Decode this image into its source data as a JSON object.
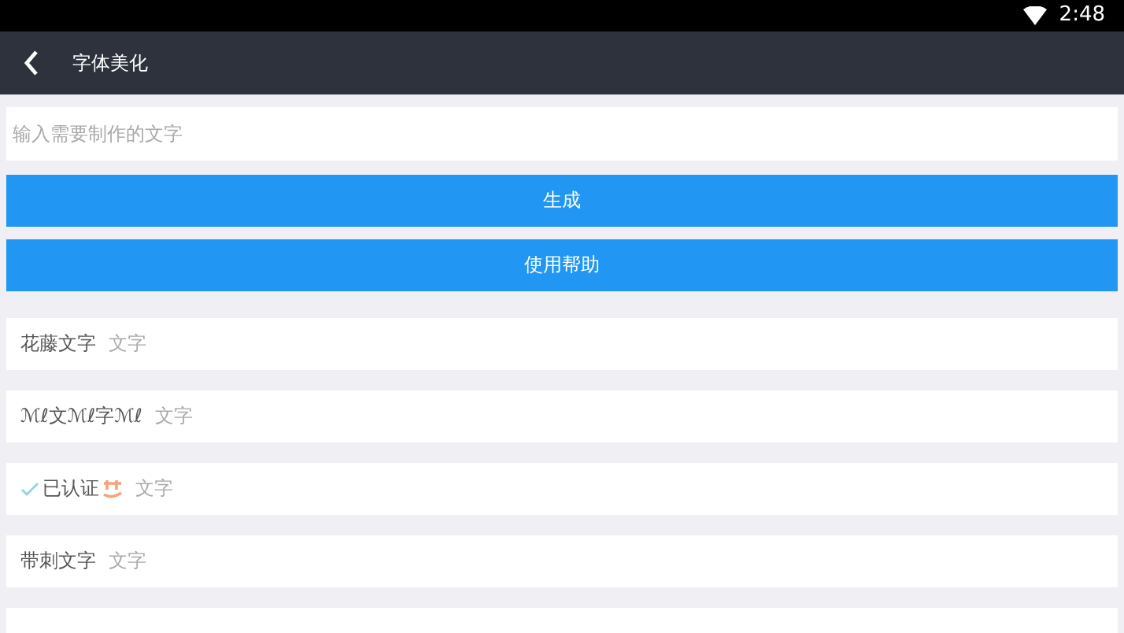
{
  "status_bar": {
    "time": "2:48"
  },
  "header": {
    "title": "字体美化"
  },
  "input": {
    "placeholder": "输入需要制作的文字"
  },
  "buttons": [
    "生成",
    "使用帮助"
  ],
  "styles": [
    {
      "kind": "plain",
      "name": "花藤文字",
      "sample": "文字"
    },
    {
      "kind": "plain",
      "name": "ℳℓ文ℳℓ字ℳℓ",
      "sample": "文字"
    },
    {
      "kind": "verified",
      "name": "已认证",
      "sample": "文字"
    },
    {
      "kind": "plain",
      "name": "带刺文字",
      "sample": "文字"
    }
  ]
}
